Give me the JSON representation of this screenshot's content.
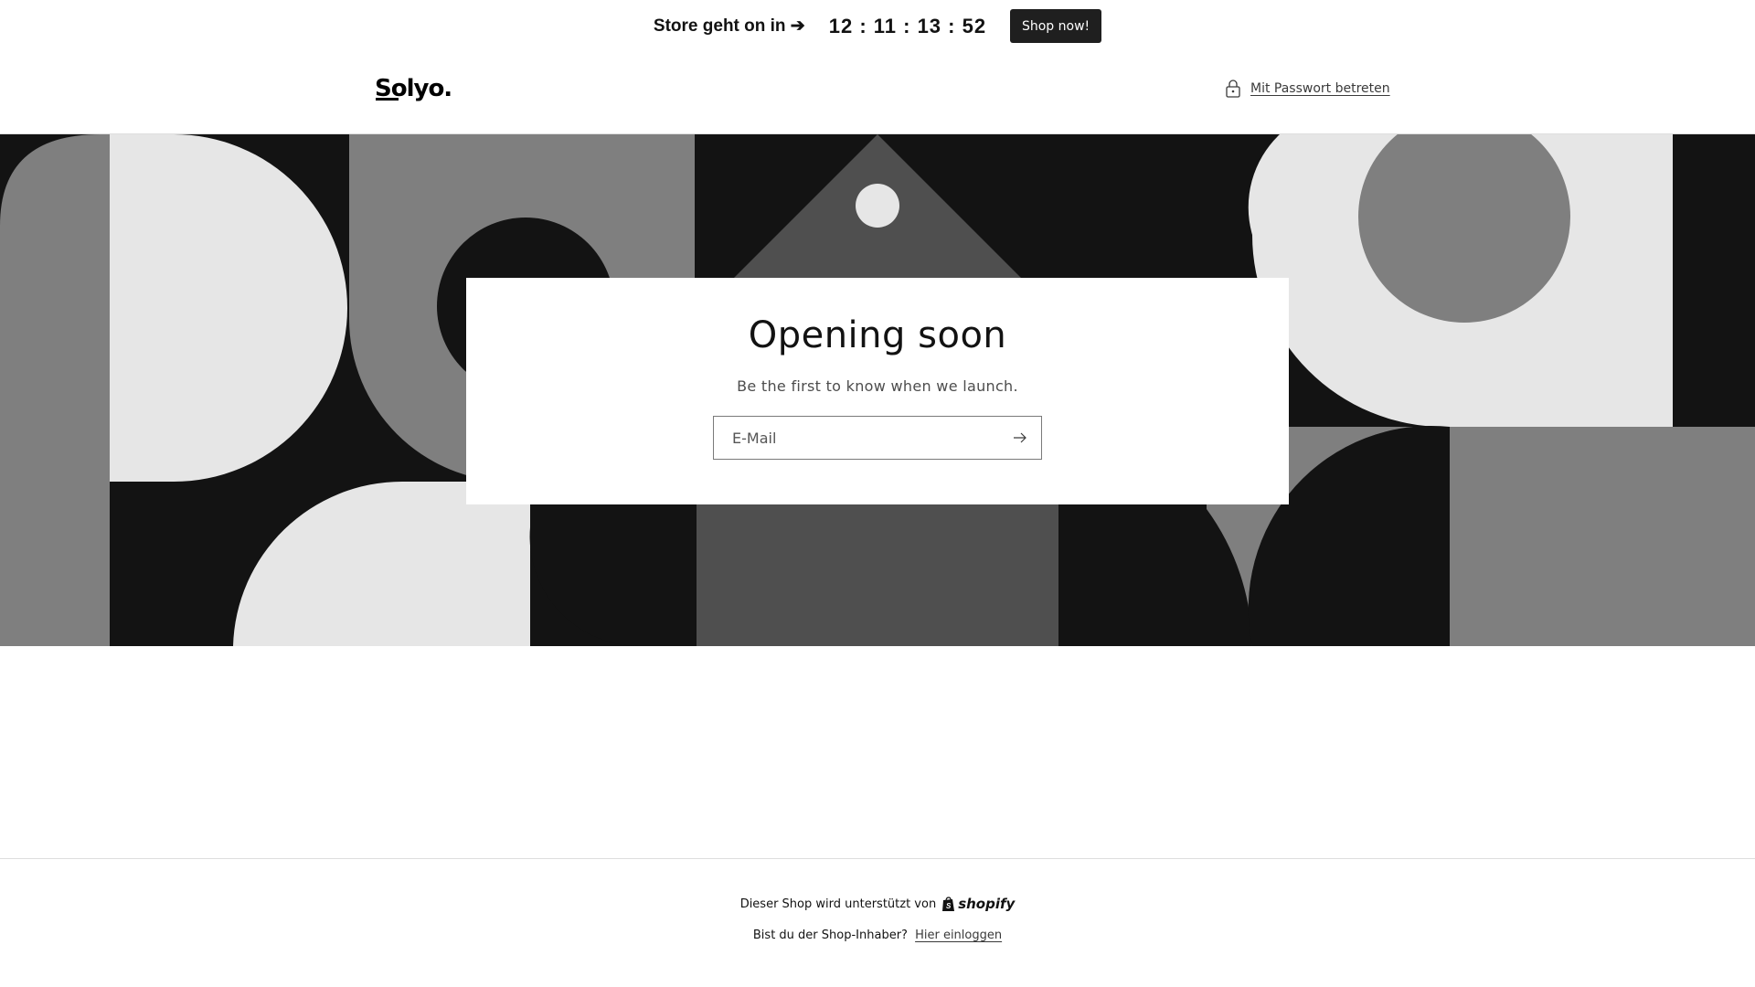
{
  "announcement": {
    "text": "Store geht on in ➔",
    "countdown": "12 : 11 : 13 : 52",
    "button_label": "Shop now!"
  },
  "header": {
    "logo": "Solyo.",
    "password_link": "Mit Passwort betreten",
    "password_icon": "lock-icon"
  },
  "hero": {
    "title": "Opening soon",
    "subtitle": "Be the first to know when we launch.",
    "email_placeholder": "E-Mail",
    "submit_icon": "arrow-right-icon"
  },
  "footer": {
    "powered_by": "Dieser Shop wird unterstützt von",
    "shopify_label": "shopify",
    "owner_question": "Bist du der Shop-Inhaber?",
    "login_link": "Hier einloggen"
  },
  "colors": {
    "black": "#131313",
    "dark_gray": "#4f4f4f",
    "mid_gray": "#7f7f7f",
    "light_gray": "#e6e6e6",
    "button_bg": "#1f1f1f"
  }
}
